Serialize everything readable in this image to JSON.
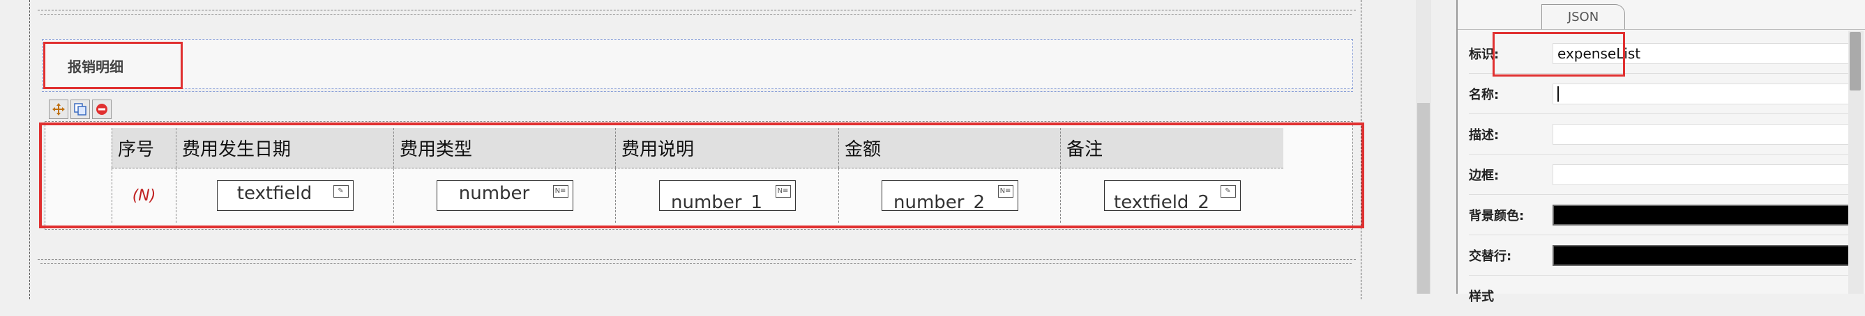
{
  "section": {
    "title": "报销明细"
  },
  "toolbar": {
    "icons": [
      "move-icon",
      "copy-icon",
      "delete-icon"
    ]
  },
  "grid": {
    "headers": [
      "序号",
      "费用发生日期",
      "费用类型",
      "费用说明",
      "金额",
      "备注"
    ],
    "sequence_marker": "(N)",
    "fields": [
      "textfield",
      "number",
      "number_1",
      "number_2",
      "textfield_2"
    ]
  },
  "panel": {
    "tab": "JSON",
    "props": [
      {
        "label": "标识:",
        "value": "expenseList"
      },
      {
        "label": "名称:",
        "value": ""
      },
      {
        "label": "描述:",
        "value": ""
      },
      {
        "label": "边框:",
        "value": ""
      },
      {
        "label": "背景颜色:",
        "value": ""
      },
      {
        "label": "交替行:",
        "value": ""
      }
    ],
    "next_label": "样式"
  },
  "colors": {
    "highlight": "#e03030",
    "swatch": "#000000"
  }
}
